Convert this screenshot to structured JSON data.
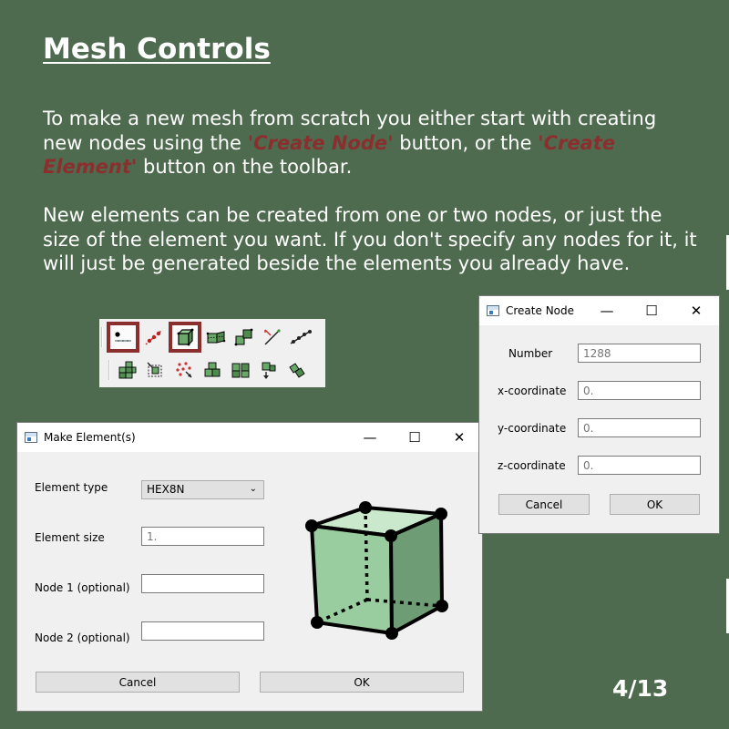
{
  "slide": {
    "title": "Mesh Controls",
    "para1_a": "To make a new mesh from scratch you either start with creating new nodes using the ",
    "para1_hl1": "'Create Node'",
    "para1_b": " button, or the ",
    "para1_hl2": "'Create Element'",
    "para1_c": " button on the toolbar.",
    "para2": "New elements can be created from one or two nodes, or just the size of the element you want. If you don't specify any nodes for it, it will just be generated beside the elements you already have.",
    "page_number": "4/13",
    "highlight_color": "#8b2e2e",
    "background_color": "#4f6b4f"
  },
  "toolbar": {
    "row1": [
      "create-node-icon",
      "node-pair-icon",
      "create-element-icon",
      "element-grid-icon",
      "element-cluster-icon",
      "line-node-icon",
      "node-chain-icon"
    ],
    "row2": [
      "mesh-block-icon",
      "element-select-icon",
      "scatter-nodes-icon",
      "mesh-stack-icon",
      "mesh-split-icon",
      "mesh-move-icon",
      "mesh-rotate-icon"
    ],
    "selected": [
      "create-node-icon",
      "create-element-icon"
    ]
  },
  "make_element": {
    "title": "Make Element(s)",
    "element_type_label": "Element type",
    "element_type_value": "HEX8N",
    "element_size_label": "Element size",
    "element_size_placeholder": "1.",
    "node1_label": "Node 1 (optional)",
    "node2_label": "Node 2 (optional)",
    "cancel": "Cancel",
    "ok": "OK"
  },
  "create_node": {
    "title": "Create Node",
    "number_label": "Number",
    "number_placeholder": "1288",
    "x_label": "x-coordinate",
    "x_placeholder": "0.",
    "y_label": "y-coordinate",
    "y_placeholder": "0.",
    "z_label": "z-coordinate",
    "z_placeholder": "0.",
    "cancel": "Cancel",
    "ok": "OK"
  },
  "window_controls": {
    "minimize": "—",
    "maximize": "☐",
    "close": "✕"
  }
}
